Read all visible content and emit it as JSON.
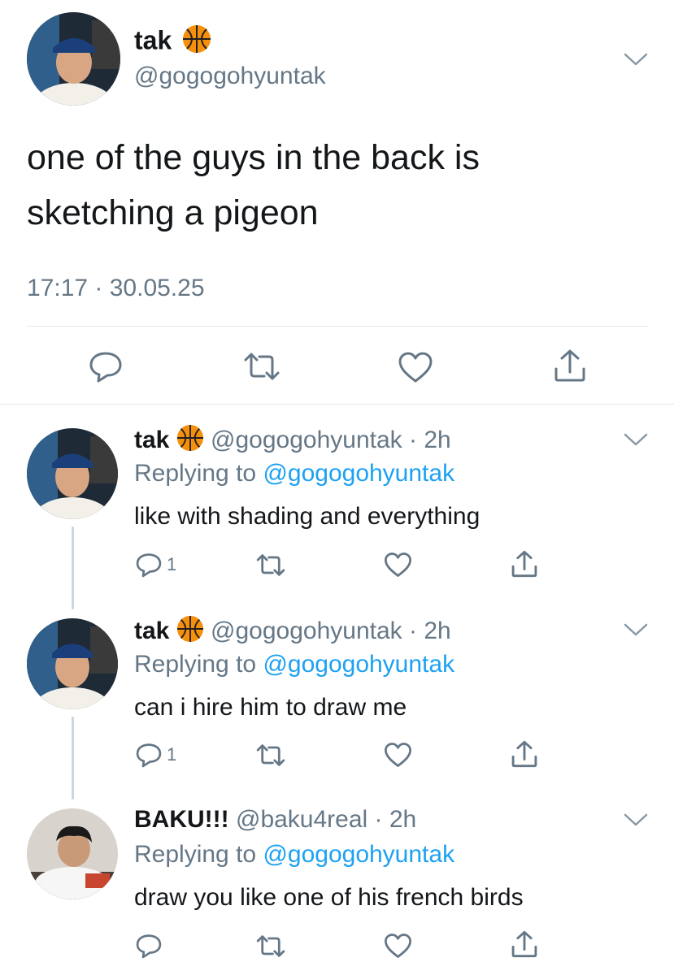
{
  "main_tweet": {
    "display_name": "tak",
    "emoji": "basketball",
    "handle": "@gogogohyuntak",
    "text_line1": "one of the guys in the back is",
    "text_line2": "sketching a pigeon",
    "timestamp": "17:17 · 30.05.25",
    "icons": [
      "chevron-down-icon",
      "reply-icon",
      "retweet-icon",
      "like-icon",
      "share-icon"
    ]
  },
  "replies": [
    {
      "display_name": "tak",
      "emoji": "basketball",
      "handle": "@gogogohyuntak",
      "time": "· 2h",
      "replying_prefix": "Replying to",
      "replying_handle": "@gogogohyuntak",
      "text": "like with shading and everything",
      "reply_count": "1"
    },
    {
      "display_name": "tak",
      "emoji": "basketball",
      "handle": "@gogogohyuntak",
      "time": "· 2h",
      "replying_prefix": "Replying to",
      "replying_handle": "@gogogohyuntak",
      "text": "can i hire him to draw me",
      "reply_count": "1"
    },
    {
      "display_name": "BAKU!!!",
      "handle": "@baku4real",
      "time": "· 2h",
      "replying_prefix": "Replying to",
      "replying_handle": "@gogogohyuntak",
      "text": "draw you like one of his french birds",
      "reply_count": ""
    }
  ],
  "colors": {
    "text": "#14171a",
    "secondary": "#657786",
    "link": "#1da1f2",
    "divider": "#e1e8ed",
    "thread_line": "#ccd6dd"
  }
}
